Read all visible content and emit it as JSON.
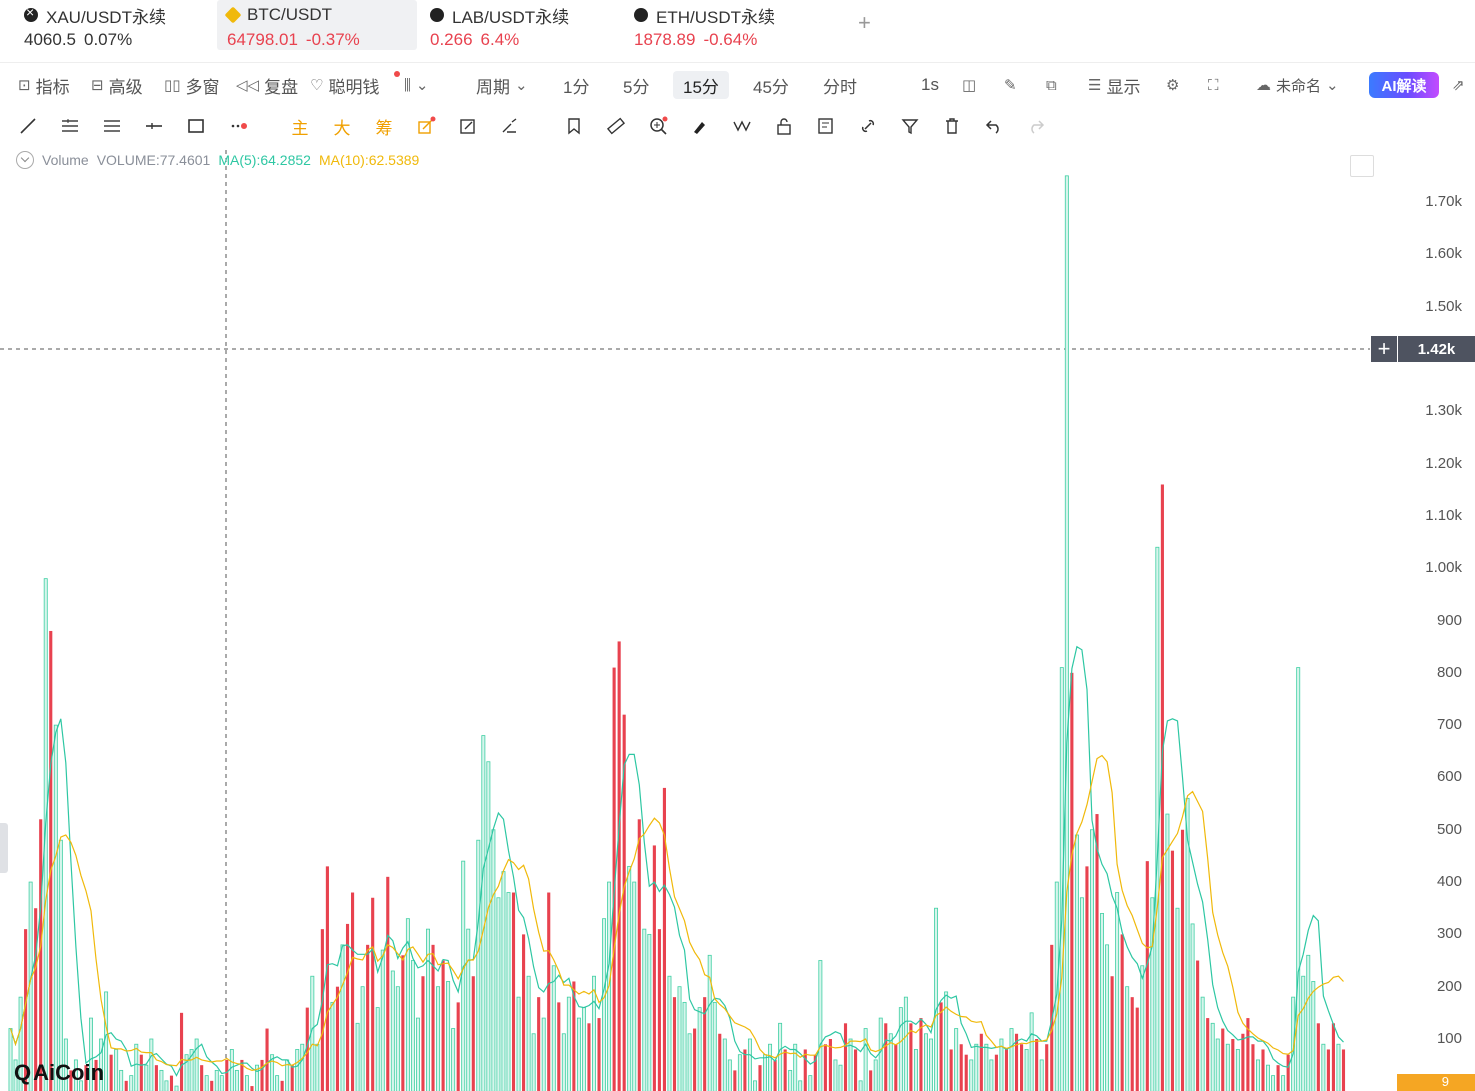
{
  "tickers": [
    {
      "icon": "xau-coin-icon",
      "name": "XAU/USDT永续",
      "price": "4060.5",
      "change": "0.07%",
      "color": "neutral"
    },
    {
      "icon": "btc-coin-icon",
      "name": "BTC/USDT",
      "price": "64798.01",
      "change": "-0.37%",
      "color": "red"
    },
    {
      "icon": "lab-coin-icon",
      "name": "LAB/USDT永续",
      "price": "0.266",
      "change": "6.4%",
      "color": "red"
    },
    {
      "icon": "eth-coin-icon",
      "name": "ETH/USDT永续",
      "price": "1878.89",
      "change": "-0.64%",
      "color": "red"
    }
  ],
  "add_tab": "+",
  "toolbar": {
    "indicators": "指标",
    "advanced": "高级",
    "multi_window": "多窗",
    "replay": "复盘",
    "smart_money": "聪明钱",
    "period": "周期",
    "intervals": [
      "1分",
      "5分",
      "15分",
      "45分",
      "分时"
    ],
    "selected_interval": "15分",
    "one_second": "1s",
    "display": "显示",
    "unnamed": "未命名",
    "ai_button": "AI解读"
  },
  "drawing_tools": {
    "main": "主",
    "big": "大",
    "chips": "筹"
  },
  "legend": {
    "title": "Volume",
    "volume": "VOLUME:77.4601",
    "ma5": "MA(5):64.2852",
    "ma10": "MA(10):62.5389"
  },
  "crosshair_value": "1.42k",
  "bottom_badge": "9",
  "logo_text": "AiCoin",
  "chart_data": {
    "type": "bar",
    "title": "Volume",
    "ylim": [
      0,
      1750
    ],
    "y_ticks": [
      "1.70k",
      "1.60k",
      "1.50k",
      "1.30k",
      "1.20k",
      "1.10k",
      "1.00k",
      "900",
      "800",
      "700",
      "600",
      "500",
      "400",
      "300",
      "200",
      "100"
    ],
    "y_tick_values": [
      1700,
      1600,
      1500,
      1300,
      1200,
      1100,
      1000,
      900,
      800,
      700,
      600,
      500,
      400,
      300,
      200,
      100
    ],
    "colors": {
      "up": "#3fcfa3",
      "down": "#e8424f",
      "ma5": "#2ec7a3",
      "ma10": "#f0b90b"
    },
    "values": [
      120,
      60,
      180,
      310,
      400,
      350,
      520,
      980,
      880,
      700,
      480,
      100,
      40,
      60,
      20,
      50,
      140,
      60,
      100,
      190,
      70,
      80,
      40,
      20,
      30,
      90,
      70,
      50,
      100,
      50,
      40,
      20,
      30,
      10,
      150,
      70,
      80,
      100,
      50,
      30,
      20,
      40,
      30,
      60,
      80,
      40,
      60,
      30,
      10,
      50,
      60,
      120,
      70,
      30,
      20,
      60,
      50,
      80,
      90,
      160,
      220,
      90,
      310,
      430,
      170,
      200,
      280,
      320,
      380,
      130,
      200,
      280,
      370,
      160,
      270,
      410,
      230,
      200,
      260,
      330,
      250,
      140,
      220,
      310,
      280,
      200,
      250,
      210,
      120,
      170,
      440,
      310,
      220,
      480,
      680,
      630,
      500,
      370,
      420,
      380,
      380,
      180,
      300,
      220,
      110,
      180,
      140,
      380,
      240,
      170,
      110,
      180,
      210,
      140,
      160,
      130,
      220,
      140,
      330,
      400,
      810,
      860,
      720,
      430,
      400,
      520,
      310,
      300,
      470,
      310,
      580,
      220,
      180,
      200,
      170,
      110,
      120,
      160,
      180,
      260,
      170,
      110,
      100,
      60,
      40,
      70,
      80,
      100,
      20,
      50,
      70,
      90,
      60,
      130,
      80,
      40,
      90,
      20,
      80,
      30,
      70,
      250,
      90,
      100,
      60,
      50,
      130,
      100,
      80,
      20,
      120,
      40,
      60,
      140,
      130,
      110,
      90,
      160,
      180,
      130,
      80,
      140,
      110,
      100,
      350,
      170,
      190,
      80,
      120,
      90,
      70,
      60,
      90,
      110,
      90,
      60,
      70,
      100,
      80,
      120,
      110,
      90,
      80,
      150,
      100,
      60,
      90,
      280,
      400,
      810,
      1750,
      800,
      490,
      370,
      430,
      500,
      530,
      340,
      280,
      220,
      380,
      300,
      200,
      180,
      160,
      240,
      440,
      370,
      1040,
      1160,
      530,
      460,
      350,
      500,
      560,
      320,
      250,
      180,
      140,
      130,
      100,
      120,
      90,
      100,
      80,
      110,
      140,
      90,
      60,
      80,
      50,
      30,
      50,
      30,
      70,
      180,
      810,
      220,
      260,
      210,
      130,
      90,
      80,
      130,
      90,
      80
    ],
    "up_flags": [
      1,
      1,
      1,
      0,
      1,
      0,
      0,
      1,
      0,
      1,
      1,
      1,
      0,
      1,
      1,
      0,
      1,
      0,
      1,
      1,
      0,
      1,
      1,
      0,
      1,
      1,
      0,
      1,
      1,
      0,
      1,
      1,
      0,
      1,
      0,
      1,
      1,
      1,
      0,
      1,
      0,
      1,
      1,
      0,
      1,
      1,
      0,
      1,
      0,
      1,
      0,
      0,
      1,
      1,
      0,
      1,
      0,
      1,
      1,
      0,
      1,
      1,
      0,
      0,
      1,
      0,
      1,
      0,
      0,
      1,
      1,
      0,
      0,
      1,
      1,
      0,
      1,
      1,
      0,
      1,
      1,
      1,
      0,
      1,
      0,
      1,
      0,
      1,
      1,
      0,
      1,
      1,
      0,
      1,
      1,
      1,
      1,
      1,
      1,
      1,
      0,
      1,
      0,
      1,
      1,
      0,
      1,
      0,
      1,
      0,
      1,
      1,
      0,
      1,
      1,
      0,
      1,
      0,
      1,
      1,
      0,
      0,
      0,
      1,
      1,
      0,
      1,
      1,
      0,
      0,
      0,
      1,
      0,
      1,
      1,
      1,
      0,
      1,
      0,
      1,
      1,
      0,
      1,
      1,
      0,
      1,
      0,
      1,
      1,
      0,
      1,
      1,
      0,
      1,
      0,
      1,
      1,
      1,
      0,
      1,
      0,
      1,
      0,
      0,
      1,
      1,
      0,
      1,
      0,
      1,
      1,
      0,
      1,
      1,
      0,
      1,
      0,
      1,
      1,
      0,
      1,
      0,
      1,
      1,
      1,
      0,
      1,
      0,
      1,
      0,
      0,
      1,
      1,
      0,
      1,
      1,
      0,
      1,
      0,
      1,
      0,
      0,
      1,
      1,
      0,
      1,
      0,
      0,
      1,
      1,
      1,
      0,
      1,
      1,
      0,
      1,
      0,
      1,
      1,
      0,
      1,
      0,
      1,
      0,
      0,
      1,
      0,
      1,
      1,
      0,
      1,
      0,
      1,
      0,
      1,
      1,
      0,
      1,
      0,
      1,
      1,
      0,
      1,
      0,
      1,
      0,
      0,
      0,
      1,
      0,
      1,
      1,
      0,
      1,
      0,
      1,
      1,
      1,
      1,
      1,
      0,
      1,
      0,
      0,
      1,
      0,
      1,
      0,
      0,
      0
    ]
  }
}
